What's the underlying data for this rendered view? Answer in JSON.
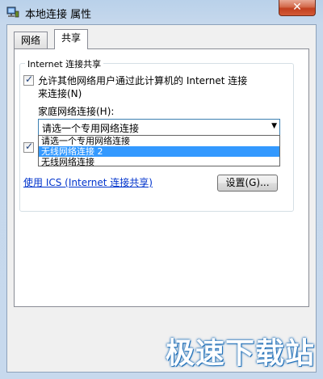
{
  "window": {
    "title": "本地连接 属性",
    "close_glyph": "✕"
  },
  "tabs": [
    {
      "label": "网络",
      "active": false
    },
    {
      "label": "共享",
      "active": true
    }
  ],
  "sharing": {
    "group_title": "Internet 连接共享",
    "allow_sharing": {
      "checked": true,
      "label_line1": "允许其他网络用户通过此计算机的 Internet 连接",
      "label_line2": "来连接(N)"
    },
    "home_network": {
      "label": "家庭网络连接(H):",
      "selected": "请选一个专用网络连接",
      "options": [
        "请选一个专用网络连接",
        "无线网络连接 2",
        "无线网络连接"
      ],
      "highlighted_index": 1
    },
    "allow_control": {
      "checked": true
    },
    "ics_link": "使用 ICS (Internet 连接共享)",
    "settings_button": "设置(G)..."
  },
  "watermark": "极速下载站",
  "colors": {
    "selection": "#3399ff",
    "link": "#0033cc",
    "close": "#c2401f"
  }
}
